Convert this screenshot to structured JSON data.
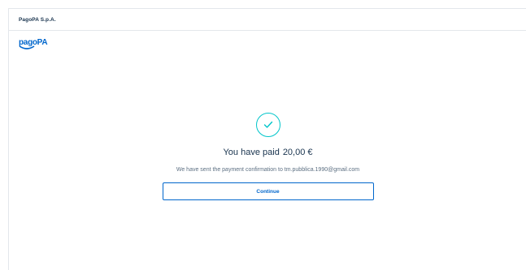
{
  "header": {
    "company": "PagoPA S.p.A."
  },
  "logo": {
    "text": "pagoPA",
    "color": "#0066cc"
  },
  "result": {
    "icon": "check-circle-icon",
    "accent_color": "#00c5ca",
    "title": "You have paid",
    "amount": "20,00 €",
    "message": "We have sent the payment confirmation to tm.pubblica.1990@gmail.com",
    "continue_label": "Continue"
  }
}
